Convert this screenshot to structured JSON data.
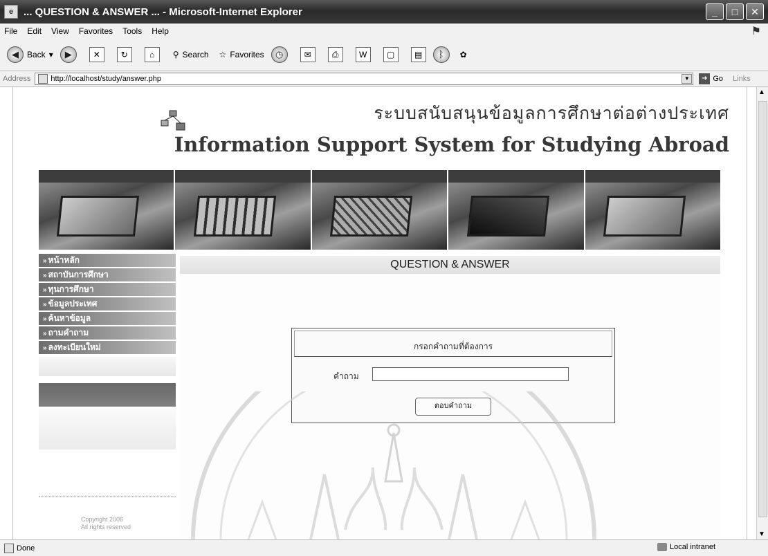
{
  "window": {
    "title": "... QUESTION & ANSWER ... - Microsoft-Internet Explorer",
    "buttons": [
      "minimize",
      "maximize",
      "close"
    ]
  },
  "menu": [
    "File",
    "Edit",
    "View",
    "Favorites",
    "Tools",
    "Help"
  ],
  "toolbar": {
    "back_label": "Back",
    "search_label": "Search",
    "favorites_label": "Favorites"
  },
  "address": {
    "label": "Address",
    "url": "http://localhost/study/answer.php",
    "go_label": "Go",
    "links_label": "Links"
  },
  "page": {
    "title_thai": "ระบบสนับสนุนข้อมูลการศึกษาต่อต่างประเทศ",
    "title_en": "Information Support System for Studying Abroad",
    "section_title": "QUESTION & ANSWER",
    "nav": [
      "หน้าหลัก",
      "สถาบันการศึกษา",
      "ทุนการศึกษา",
      "ข้อมูลประเทศ",
      "ค้นหาข้อมูล",
      "ถามคำถาม",
      "ลงทะเบียนใหม่"
    ],
    "form": {
      "header": "กรอกคำถามที่ต้องการ",
      "field_label": "คำถาม",
      "field_value": "",
      "submit_label": "ตอบคำถาม"
    },
    "copyright": [
      "Copyright 2006",
      "All rights reserved"
    ]
  },
  "status": {
    "left": "Done",
    "zone": "Local intranet"
  }
}
